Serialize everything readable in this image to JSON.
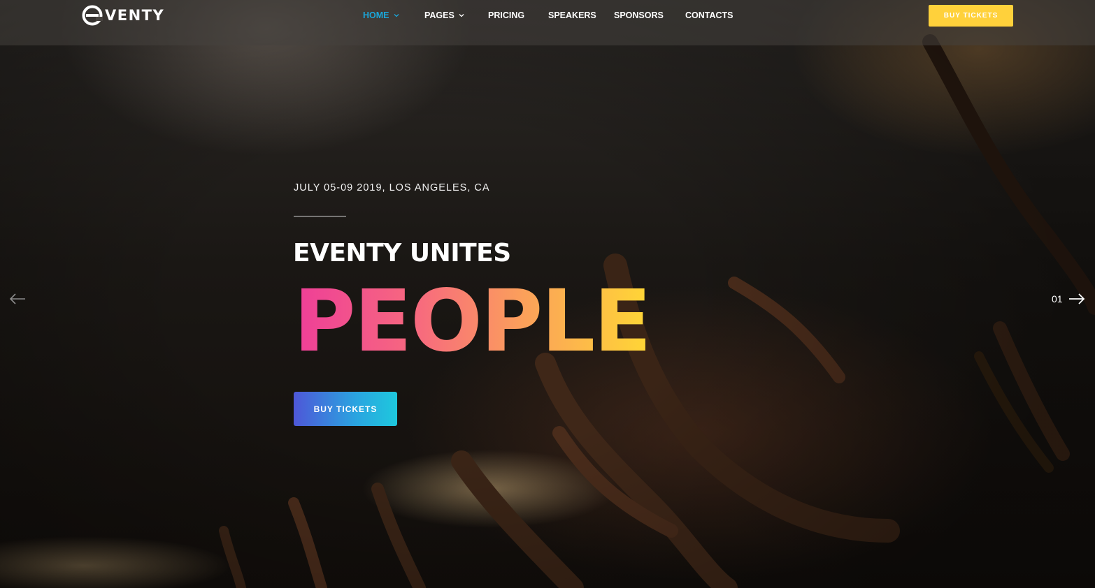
{
  "header": {
    "logo_text": "VENTY",
    "nav": [
      {
        "label": "HOME",
        "dropdown": true,
        "active": true
      },
      {
        "label": "PAGES",
        "dropdown": true,
        "active": false
      },
      {
        "label": "PRICING",
        "dropdown": false,
        "active": false
      },
      {
        "label": "SPEAKERS",
        "dropdown": false,
        "active": false
      },
      {
        "label": "SPONSORS",
        "dropdown": false,
        "active": false
      },
      {
        "label": "CONTACTS",
        "dropdown": false,
        "active": false
      }
    ],
    "cta_label": "BUY TICKETS"
  },
  "hero": {
    "event_date": "JULY 05-09 2019, LOS ANGELES, CA",
    "headline": "EVENTY UNITES",
    "big_word": "PEOPLE",
    "cta_label": "BUY TICKETS",
    "slide_number": "01"
  },
  "colors": {
    "nav_active": "#1ba6d9",
    "header_cta": "#ffd13b",
    "gradient_word_start": "#ee3e98",
    "gradient_word_end": "#ffd735",
    "hero_cta_start": "#4e57d8",
    "hero_cta_end": "#1ec8dd"
  },
  "icons": {
    "prev": "arrow-left-icon",
    "next": "arrow-right-icon",
    "dropdown": "chevron-down-icon"
  }
}
